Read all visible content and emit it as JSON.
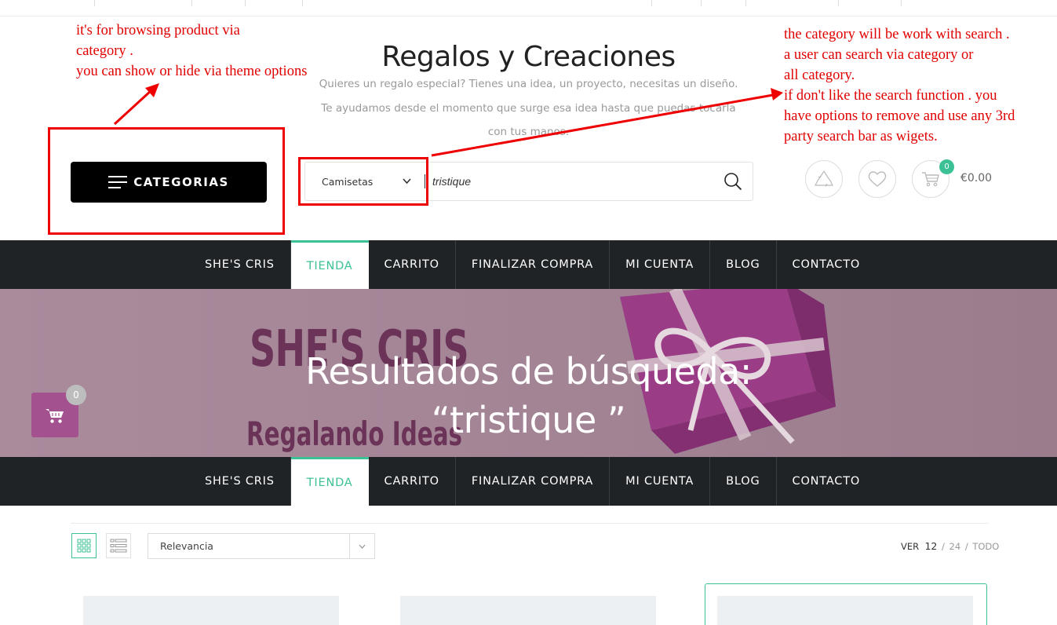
{
  "annotations": {
    "left": [
      "it's for browsing product via",
      "category .",
      "you can show or hide via theme options"
    ],
    "right": [
      "the category will be work with search .",
      "a user can search via category or",
      "all category.",
      "if don't like the search function . you",
      "have options to remove and use any 3rd",
      "party search bar as wigets."
    ]
  },
  "header": {
    "title": "Regalos y Creaciones",
    "description": [
      "Quieres un regalo especial? Tienes una idea, un proyecto, necesitas un diseño.",
      "Te ayudamos desde el momento que surge esa idea hasta que puedas tocarla",
      "con tus manos."
    ],
    "categories_label": "CATEGORIAS",
    "search": {
      "category": "Camisetas",
      "query": "tristique"
    },
    "cart": {
      "count": "0",
      "total": "€0.00"
    }
  },
  "nav": {
    "items": [
      {
        "label": "SHE'S CRIS",
        "active": false
      },
      {
        "label": "TIENDA",
        "active": true
      },
      {
        "label": "CARRITO",
        "active": false
      },
      {
        "label": "FINALIZAR COMPRA",
        "active": false
      },
      {
        "label": "MI CUENTA",
        "active": false
      },
      {
        "label": "BLOG",
        "active": false
      },
      {
        "label": "CONTACTO",
        "active": false
      }
    ]
  },
  "hero": {
    "brand_line1": "SHE'S CRIS",
    "brand_line2": "Regalando Ideas",
    "heading_line1": "Resultados de búsqueda:",
    "heading_line2": "“tristique ”"
  },
  "float_cart": {
    "count": "0"
  },
  "toolbar": {
    "sort": "Relevancia",
    "per_page_label": "VER",
    "per_page_options": [
      "12",
      "24",
      "TODO"
    ]
  },
  "colors": {
    "accent": "#3cc196",
    "nav_bg": "#1f2326",
    "annotation": "#ee0000",
    "float_cart": "#a4528f"
  }
}
